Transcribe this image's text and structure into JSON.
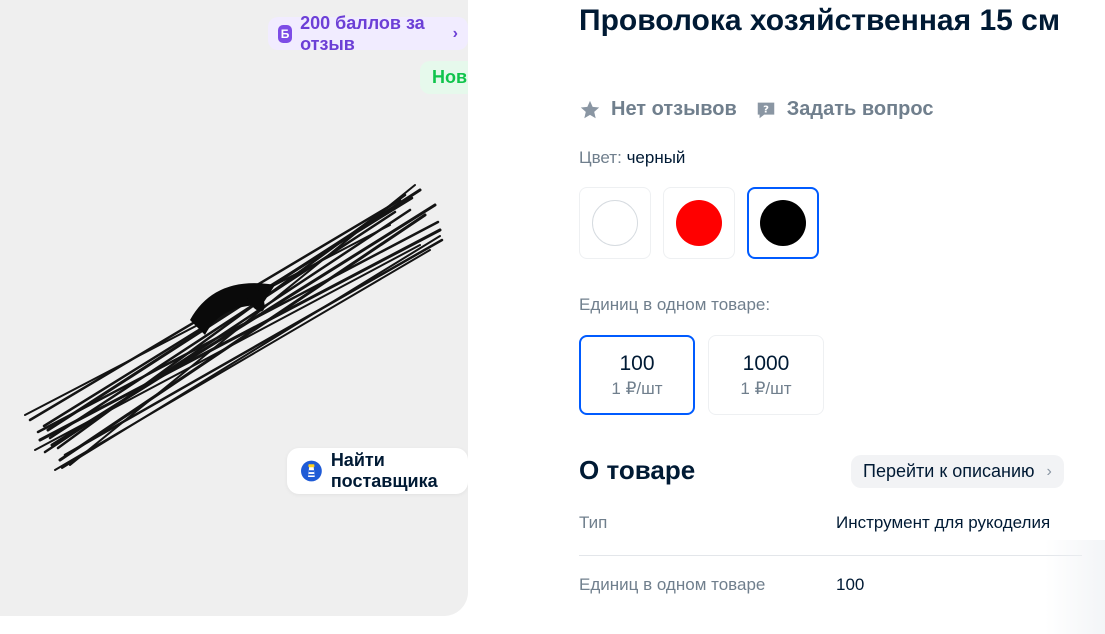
{
  "gallery": {
    "bonus_badge": {
      "icon": "bonus-b-icon",
      "letter": "Б",
      "label": "200 баллов за отзыв"
    },
    "new_badge": "Новинка",
    "find_supplier": {
      "icon": "lighthouse-icon",
      "label": "Найти поставщика"
    },
    "image": "black-wire-bundle"
  },
  "product": {
    "title": "Проволока хозяйственная 15 см",
    "reviews": {
      "icon": "star-icon",
      "label": "Нет отзывов"
    },
    "question": {
      "icon": "chat-question-icon",
      "label": "Задать вопрос"
    }
  },
  "color": {
    "label": "Цвет:",
    "value": "черный",
    "swatches": [
      {
        "name": "white",
        "color": "#ffffff",
        "selected": false
      },
      {
        "name": "red",
        "color": "#ff0000",
        "selected": false
      },
      {
        "name": "black",
        "color": "#000000",
        "selected": true
      }
    ]
  },
  "units": {
    "label": "Единиц в одном товаре:",
    "options": [
      {
        "qty": "100",
        "price": "1 ₽/шт",
        "selected": true
      },
      {
        "qty": "1000",
        "price": "1 ₽/шт",
        "selected": false
      }
    ]
  },
  "about": {
    "title": "О товаре",
    "goto_label": "Перейти к описанию",
    "specs": [
      {
        "key": "Тип",
        "value": "Инструмент для рукоделия"
      },
      {
        "key": "Единиц в одном товаре",
        "value": "100"
      }
    ]
  },
  "colors": {
    "accent": "#005bff",
    "bonus": "#7d4ce6",
    "new": "#10c44c",
    "muted": "#707f8d"
  }
}
